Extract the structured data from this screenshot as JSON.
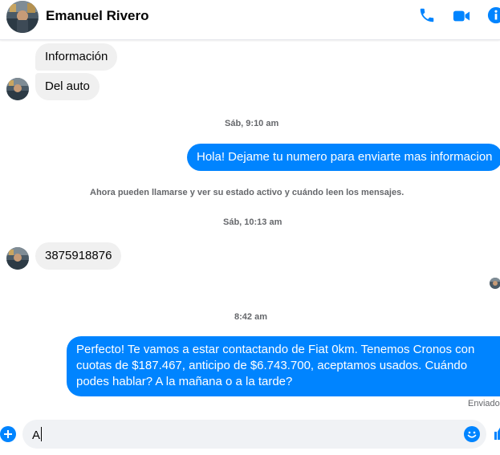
{
  "header": {
    "contact_name": "Emanuel Rivero"
  },
  "messages": {
    "in_1": "Información",
    "in_2": "Del auto",
    "ts_1": "Sáb, 9:10 am",
    "out_1": "Hola! Dejame tu numero para enviarte mas informacion",
    "notice": "Ahora pueden llamarse y ver su estado activo y cuándo leen los mensajes.",
    "ts_2": "Sáb, 10:13 am",
    "in_3": "3875918876",
    "ts_3": "8:42 am",
    "out_2": "Perfecto! Te vamos a estar contactando de Fiat 0km. Tenemos Cronos con cuotas de $187.467, anticipo de $6.743.700, aceptamos usados. Cuándo podes hablar? A la mañana o a la tarde?",
    "status": "Enviado"
  },
  "composer": {
    "value": "A"
  },
  "colors": {
    "accent": "#0084ff",
    "incoming_bubble": "#f0f0f0",
    "muted_text": "#65676b"
  },
  "icons": [
    "phone-icon",
    "video-camera-icon",
    "info-icon",
    "add-icon",
    "emoji-icon",
    "like-icon"
  ]
}
